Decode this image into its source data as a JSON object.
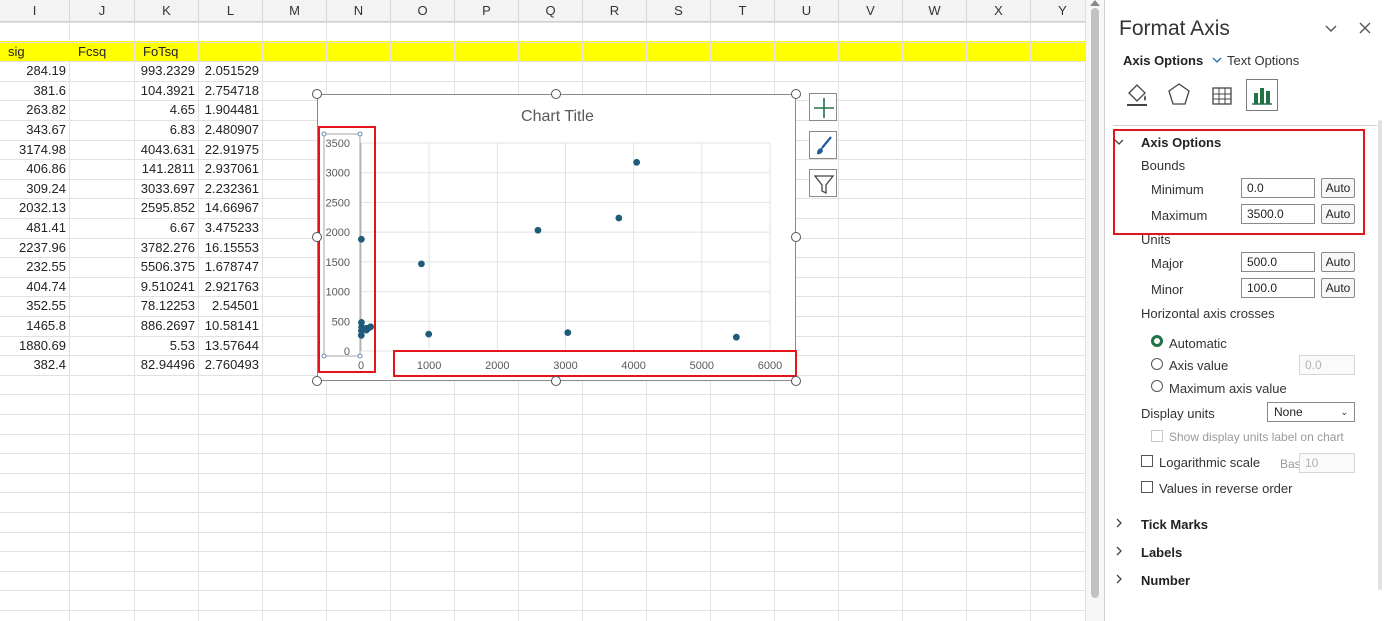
{
  "sheet": {
    "columns": [
      "I",
      "J",
      "K",
      "L",
      "M",
      "N",
      "O",
      "P",
      "Q",
      "R",
      "S",
      "T",
      "U",
      "V",
      "W",
      "X",
      "Y"
    ],
    "header_row": {
      "sig": "sig",
      "fcsq": "Fcsq",
      "fotsq": "FoTsq"
    },
    "rows": [
      {
        "i": "284.19",
        "k": "993.2329",
        "l": "2.051529"
      },
      {
        "i": "381.6",
        "k": "104.3921",
        "l": "2.754718"
      },
      {
        "i": "263.82",
        "k": "4.65",
        "l": "1.904481"
      },
      {
        "i": "343.67",
        "k": "6.83",
        "l": "2.480907"
      },
      {
        "i": "3174.98",
        "k": "4043.631",
        "l": "22.91975"
      },
      {
        "i": "406.86",
        "k": "141.2811",
        "l": "2.937061"
      },
      {
        "i": "309.24",
        "k": "3033.697",
        "l": "2.232361"
      },
      {
        "i": "2032.13",
        "k": "2595.852",
        "l": "14.66967"
      },
      {
        "i": "481.41",
        "k": "6.67",
        "l": "3.475233"
      },
      {
        "i": "2237.96",
        "k": "3782.276",
        "l": "16.15553"
      },
      {
        "i": "232.55",
        "k": "5506.375",
        "l": "1.678747"
      },
      {
        "i": "404.74",
        "k": "9.510241",
        "l": "2.921763"
      },
      {
        "i": "352.55",
        "k": "78.12253",
        "l": "2.54501"
      },
      {
        "i": "1465.8",
        "k": "886.2697",
        "l": "10.58141"
      },
      {
        "i": "1880.69",
        "k": "5.53",
        "l": "13.57644"
      },
      {
        "i": "382.4",
        "k": "82.94496",
        "l": "2.760493"
      }
    ]
  },
  "chart_data": {
    "type": "scatter",
    "title": "Chart Title",
    "xlim": [
      0,
      6000
    ],
    "ylim": [
      0,
      3500
    ],
    "x_ticks": [
      0,
      1000,
      2000,
      3000,
      4000,
      5000,
      6000
    ],
    "y_ticks": [
      0,
      500,
      1000,
      1500,
      2000,
      2500,
      3000,
      3500
    ],
    "x_tick_labels": [
      "0",
      "1000",
      "2000",
      "3000",
      "4000",
      "5000",
      "6000"
    ],
    "y_tick_labels": [
      "0",
      "500",
      "1000",
      "1500",
      "2000",
      "2500",
      "3000",
      "3500"
    ],
    "grid": true,
    "marker_color": "#1f5c7a",
    "points": [
      {
        "x": 993.2329,
        "y": 284.19
      },
      {
        "x": 104.3921,
        "y": 381.6
      },
      {
        "x": 4.65,
        "y": 263.82
      },
      {
        "x": 6.83,
        "y": 343.67
      },
      {
        "x": 4043.631,
        "y": 3174.98
      },
      {
        "x": 141.2811,
        "y": 406.86
      },
      {
        "x": 3033.697,
        "y": 309.24
      },
      {
        "x": 2595.852,
        "y": 2032.13
      },
      {
        "x": 6.67,
        "y": 481.41
      },
      {
        "x": 3782.276,
        "y": 2237.96
      },
      {
        "x": 5506.375,
        "y": 232.55
      },
      {
        "x": 9.510241,
        "y": 404.74
      },
      {
        "x": 78.12253,
        "y": 352.55
      },
      {
        "x": 886.2697,
        "y": 1465.8
      },
      {
        "x": 5.53,
        "y": 1880.69
      },
      {
        "x": 82.94496,
        "y": 382.4
      }
    ]
  },
  "pane": {
    "title": "Format Axis",
    "tab_axis_options": "Axis Options",
    "tab_text_options": "Text Options",
    "section_axis_options": "Axis Options",
    "bounds_label": "Bounds",
    "minimum_label": "Minimum",
    "minimum_value": "0.0",
    "maximum_label": "Maximum",
    "maximum_value": "3500.0",
    "auto_label": "Auto",
    "units_label": "Units",
    "major_label": "Major",
    "major_value": "500.0",
    "minor_label": "Minor",
    "minor_value": "100.0",
    "h_axis_crosses_label": "Horizontal axis crosses",
    "automatic_label": "Automatic",
    "axis_value_label": "Axis value",
    "axis_value_value": "0.0",
    "max_axis_value_label": "Maximum axis value",
    "display_units_label": "Display units",
    "display_units_value": "None",
    "show_units_label": "Show display units label on chart",
    "log_scale_label": "Logarithmic scale",
    "base_label": "Base",
    "base_value": "10",
    "reverse_label": "Values in reverse order",
    "tick_marks_label": "Tick Marks",
    "labels_label": "Labels",
    "number_label": "Number",
    "accent_color": "#217346",
    "highlight_color": "#e3151a"
  }
}
